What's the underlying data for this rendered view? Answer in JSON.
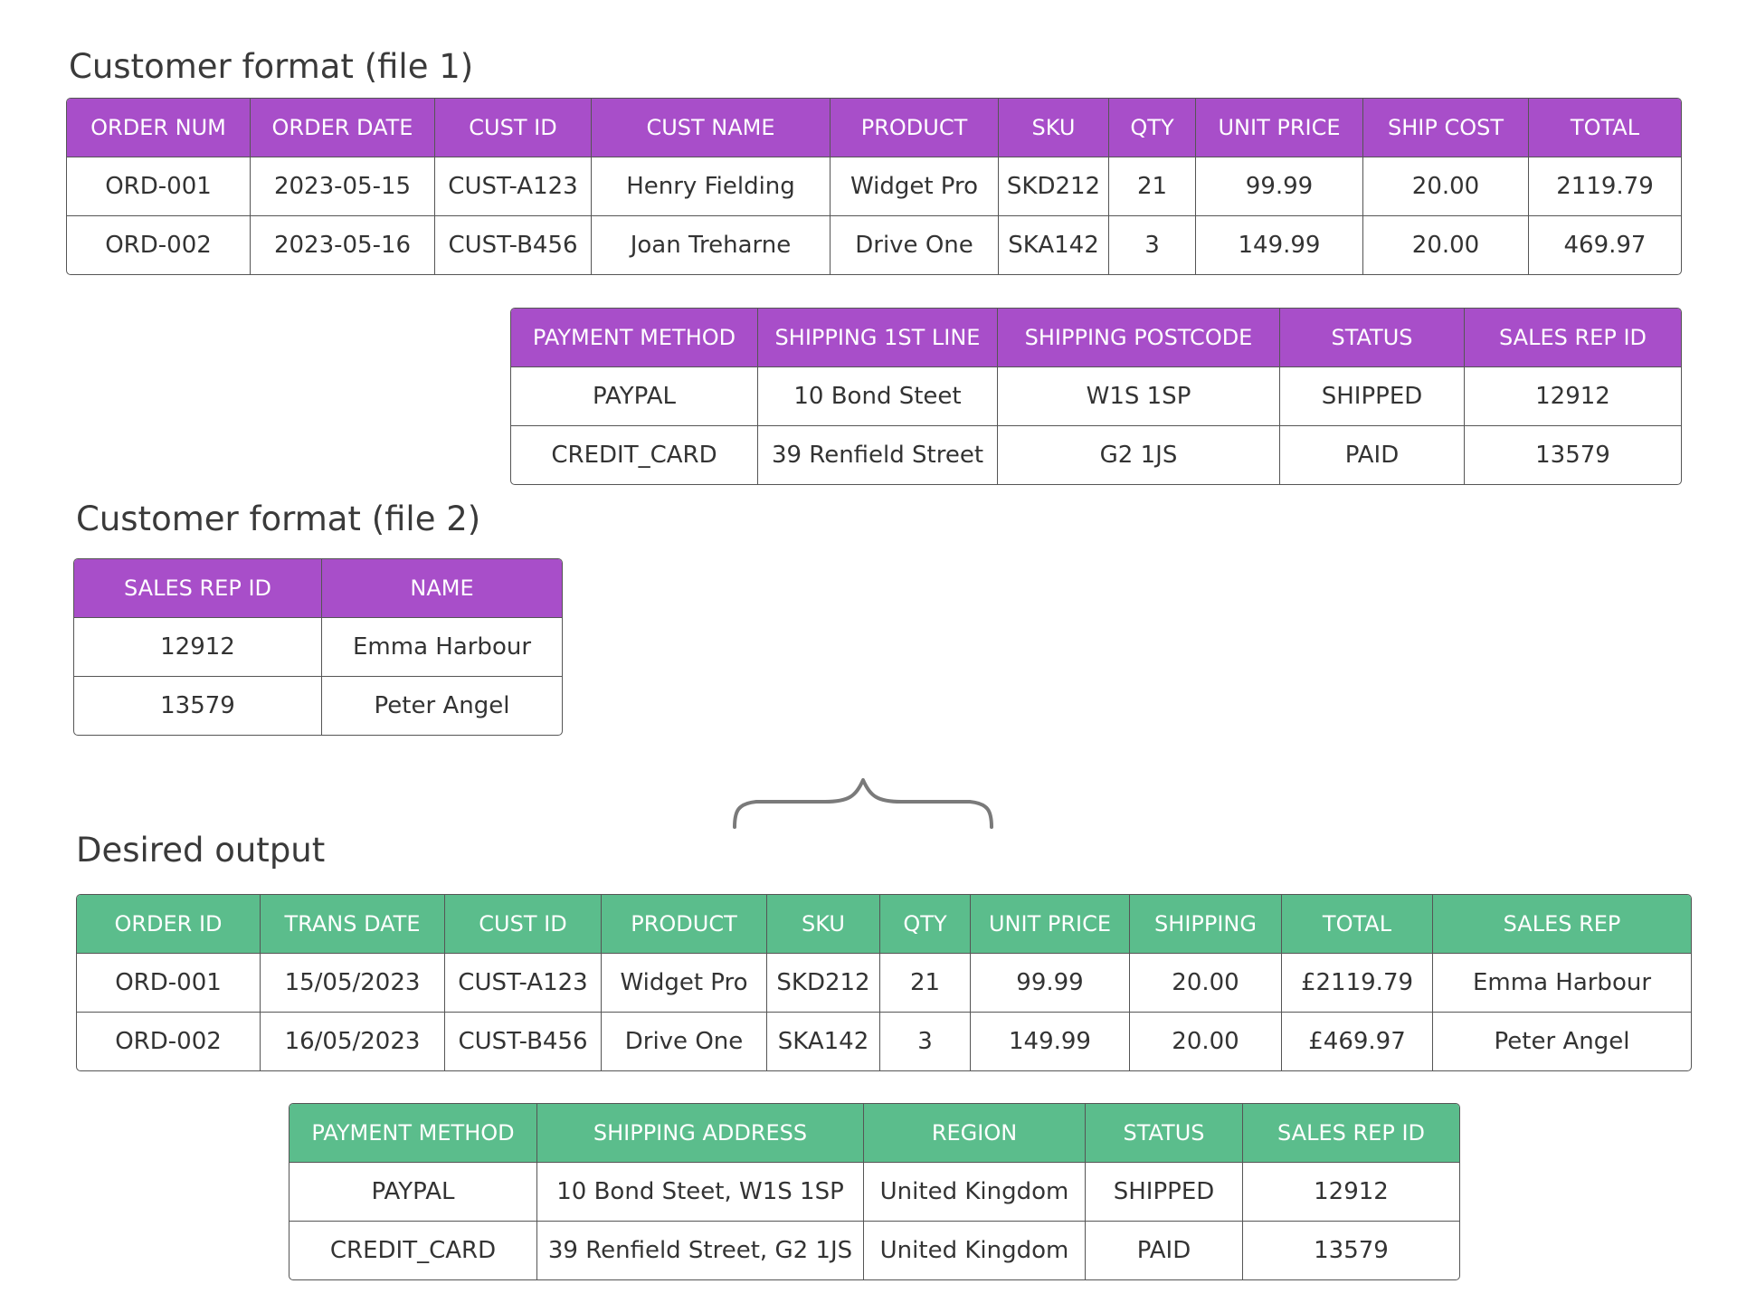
{
  "file1": {
    "title": "Customer format (file 1)",
    "table_a": {
      "headers": [
        "ORDER NUM",
        "ORDER DATE",
        "CUST ID",
        "CUST NAME",
        "PRODUCT",
        "SKU",
        "QTY",
        "UNIT PRICE",
        "SHIP COST",
        "TOTAL"
      ],
      "rows": [
        [
          "ORD-001",
          "2023-05-15",
          "CUST-A123",
          "Henry Fielding",
          "Widget Pro",
          "SKD212",
          "21",
          "99.99",
          "20.00",
          "2119.79"
        ],
        [
          "ORD-002",
          "2023-05-16",
          "CUST-B456",
          "Joan Treharne",
          "Drive One",
          "SKA142",
          "3",
          "149.99",
          "20.00",
          "469.97"
        ]
      ]
    },
    "table_b": {
      "headers": [
        "PAYMENT METHOD",
        "SHIPPING 1ST LINE",
        "SHIPPING POSTCODE",
        "STATUS",
        "SALES REP ID"
      ],
      "rows": [
        [
          "PAYPAL",
          "10 Bond Steet",
          "W1S 1SP",
          "SHIPPED",
          "12912"
        ],
        [
          "CREDIT_CARD",
          "39 Renfield Street",
          "G2 1JS",
          "PAID",
          "13579"
        ]
      ]
    }
  },
  "file2": {
    "title": "Customer format (file 2)",
    "table": {
      "headers": [
        "SALES REP ID",
        "NAME"
      ],
      "rows": [
        [
          "12912",
          "Emma Harbour"
        ],
        [
          "13579",
          "Peter Angel"
        ]
      ]
    }
  },
  "output": {
    "title": "Desired output",
    "table_a": {
      "headers": [
        "ORDER ID",
        "TRANS DATE",
        "CUST ID",
        "PRODUCT",
        "SKU",
        "QTY",
        "UNIT PRICE",
        "SHIPPING",
        "TOTAL",
        "SALES REP"
      ],
      "rows": [
        [
          "ORD-001",
          "15/05/2023",
          "CUST-A123",
          "Widget Pro",
          "SKD212",
          "21",
          "99.99",
          "20.00",
          "£2119.79",
          "Emma Harbour"
        ],
        [
          "ORD-002",
          "16/05/2023",
          "CUST-B456",
          "Drive One",
          "SKA142",
          "3",
          "149.99",
          "20.00",
          "£469.97",
          "Peter Angel"
        ]
      ]
    },
    "table_b": {
      "headers": [
        "PAYMENT METHOD",
        "SHIPPING ADDRESS",
        "REGION",
        "STATUS",
        "SALES REP ID"
      ],
      "rows": [
        [
          "PAYPAL",
          "10 Bond Steet, W1S 1SP",
          "United Kingdom",
          "SHIPPED",
          "12912"
        ],
        [
          "CREDIT_CARD",
          "39 Renfield Street, G2 1JS",
          "United Kingdom",
          "PAID",
          "13579"
        ]
      ]
    }
  },
  "colors": {
    "source_header": "#a84ec9",
    "output_header": "#5bbd8c",
    "border": "#555555",
    "brace": "#7a7a7a"
  },
  "icons": {
    "merge_brace": "curly-brace-icon"
  }
}
